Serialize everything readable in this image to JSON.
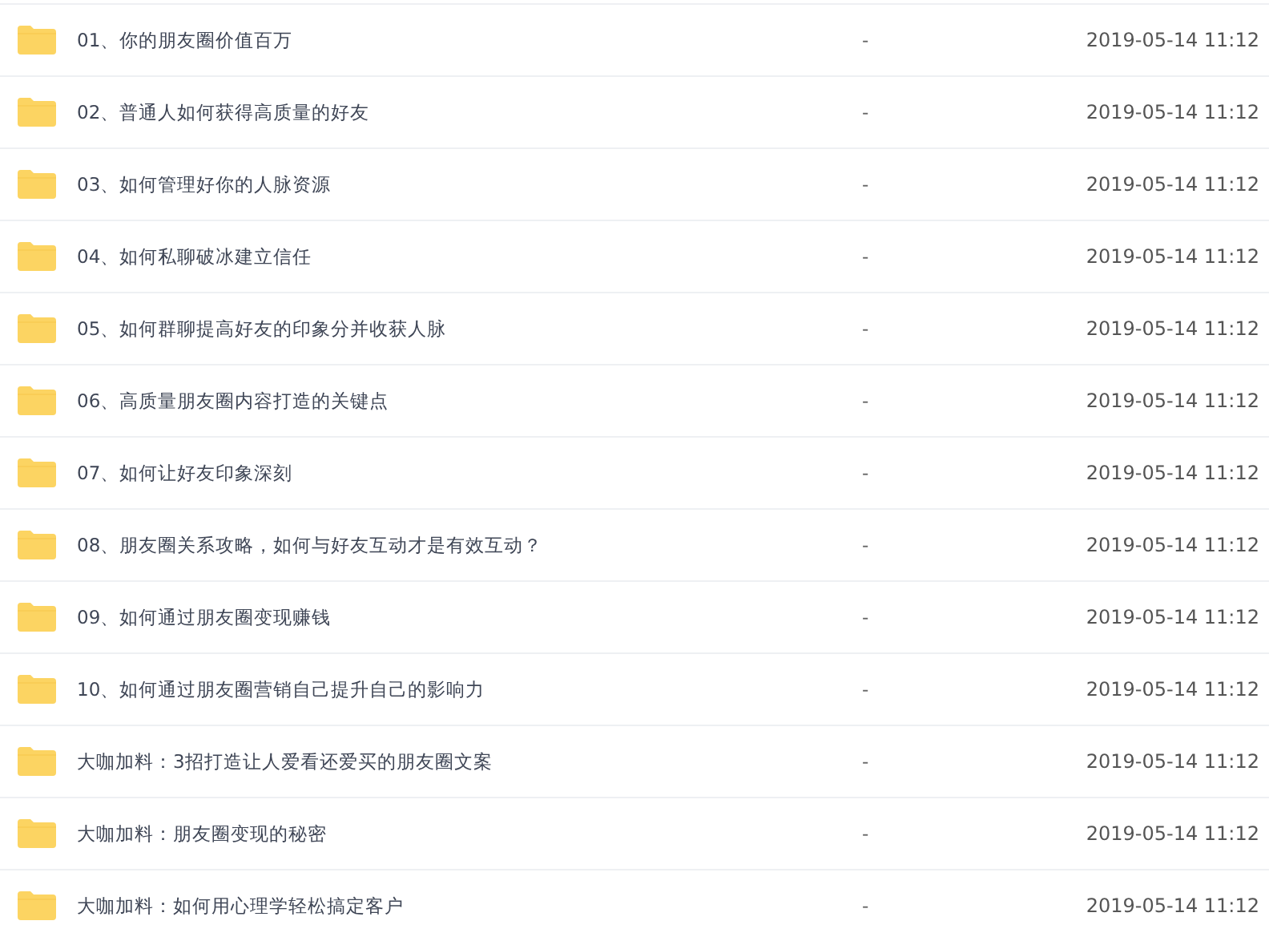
{
  "files": [
    {
      "name": "01、你的朋友圈价值百万",
      "size": "-",
      "modified": "2019-05-14 11:12"
    },
    {
      "name": "02、普通人如何获得高质量的好友",
      "size": "-",
      "modified": "2019-05-14 11:12"
    },
    {
      "name": "03、如何管理好你的人脉资源",
      "size": "-",
      "modified": "2019-05-14 11:12"
    },
    {
      "name": "04、如何私聊破冰建立信任",
      "size": "-",
      "modified": "2019-05-14 11:12"
    },
    {
      "name": "05、如何群聊提高好友的印象分并收获人脉",
      "size": "-",
      "modified": "2019-05-14 11:12"
    },
    {
      "name": "06、高质量朋友圈内容打造的关键点",
      "size": "-",
      "modified": "2019-05-14 11:12"
    },
    {
      "name": "07、如何让好友印象深刻",
      "size": "-",
      "modified": "2019-05-14 11:12"
    },
    {
      "name": "08、朋友圈关系攻略，如何与好友互动才是有效互动？",
      "size": "-",
      "modified": "2019-05-14 11:12"
    },
    {
      "name": "09、如何通过朋友圈变现赚钱",
      "size": "-",
      "modified": "2019-05-14 11:12"
    },
    {
      "name": "10、如何通过朋友圈营销自己提升自己的影响力",
      "size": "-",
      "modified": "2019-05-14 11:12"
    },
    {
      "name": "大咖加料：3招打造让人爱看还爱买的朋友圈文案",
      "size": "-",
      "modified": "2019-05-14 11:12"
    },
    {
      "name": "大咖加料：朋友圈变现的秘密",
      "size": "-",
      "modified": "2019-05-14 11:12"
    },
    {
      "name": "大咖加料：如何用心理学轻松搞定客户",
      "size": "-",
      "modified": "2019-05-14 11:12"
    }
  ]
}
